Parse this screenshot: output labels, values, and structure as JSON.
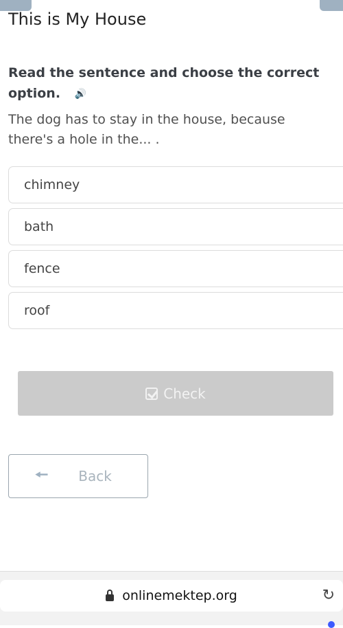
{
  "page": {
    "title": "This is My House"
  },
  "task": {
    "instruction": "Read the sentence and choose the correct option.",
    "speaker_icon": "speaker-icon",
    "question": "The dog has to stay in the house, because there's a hole in the... ."
  },
  "options": [
    {
      "label": "chimney"
    },
    {
      "label": "bath"
    },
    {
      "label": "fence"
    },
    {
      "label": "roof"
    }
  ],
  "actions": {
    "check_label": "Check",
    "check_icon": "check-square-icon",
    "back_label": "Back",
    "back_icon": "arrow-left-icon"
  },
  "browser": {
    "url": "onlinemektep.org",
    "lock_icon": "lock-icon",
    "reload_icon": "reload-icon"
  },
  "colors": {
    "check_button_disabled": "#cbcbcb",
    "back_accent": "#9fb1c1"
  }
}
